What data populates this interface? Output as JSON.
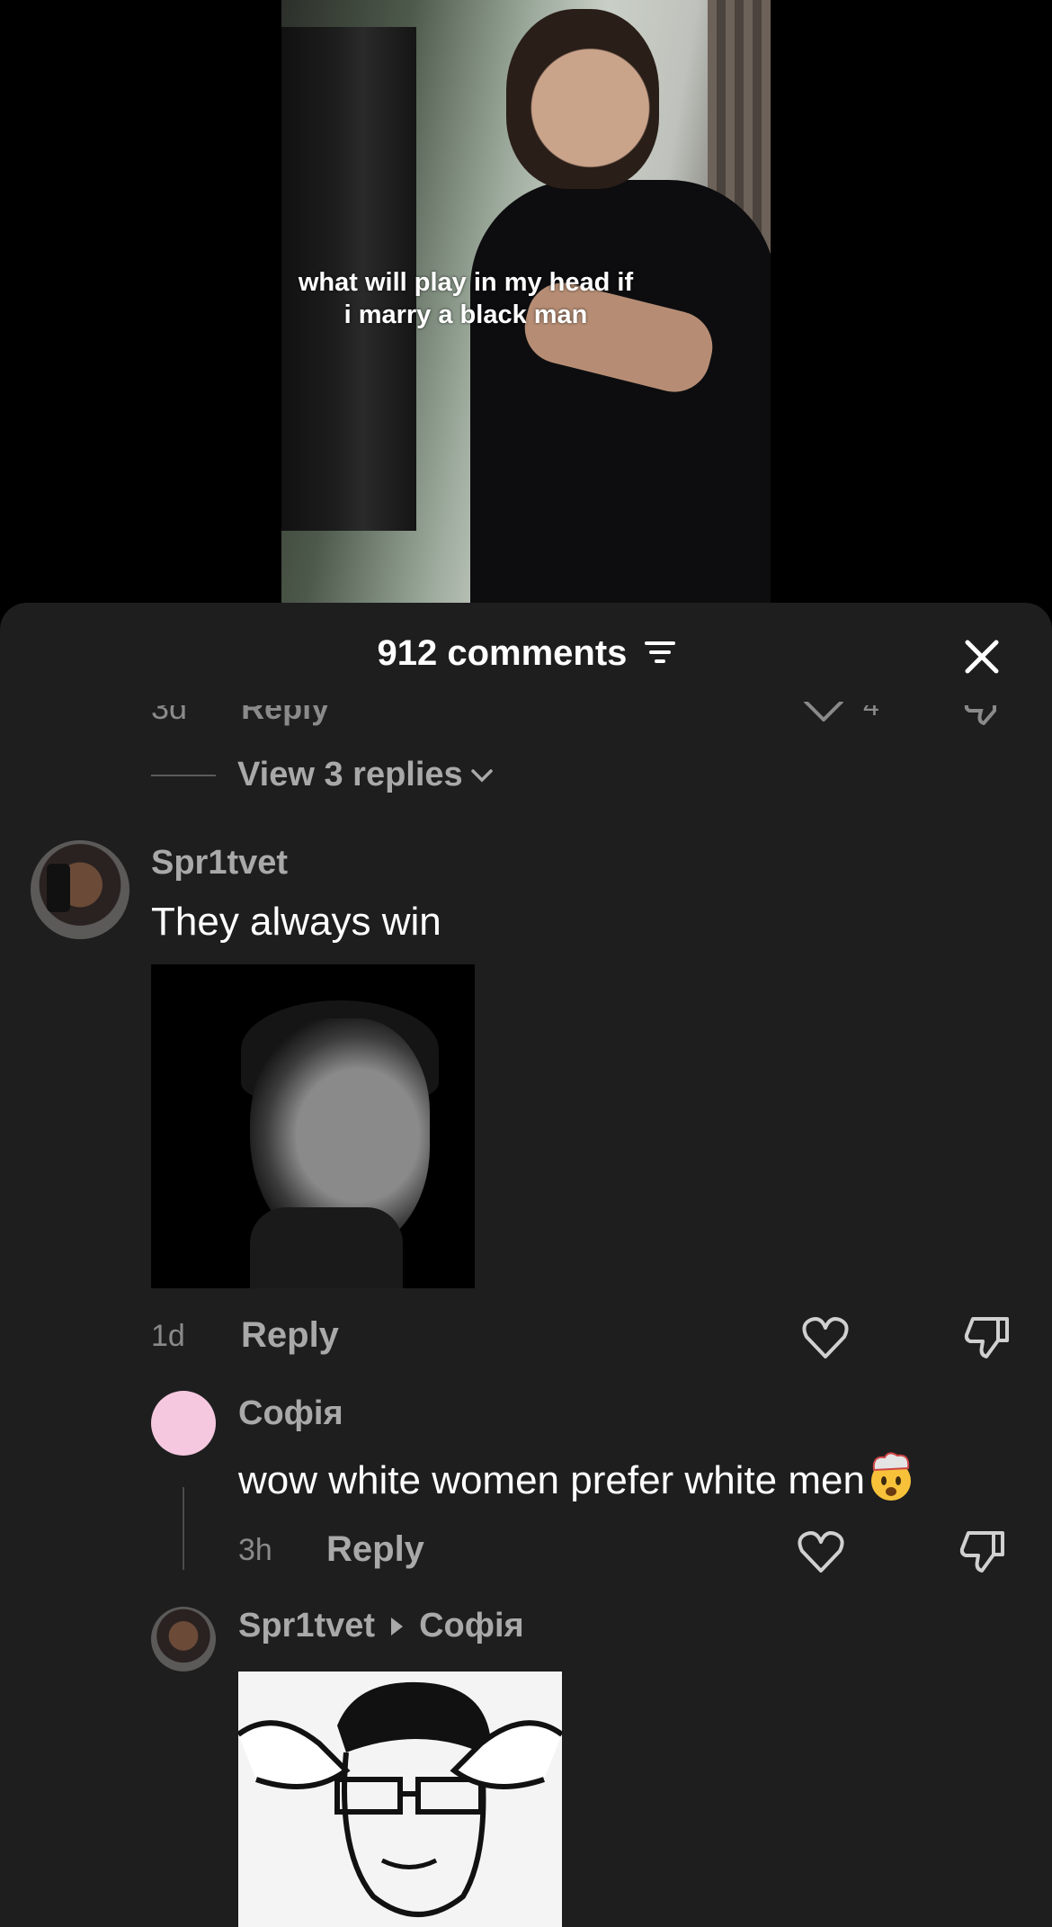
{
  "video": {
    "caption_line1": "what will play in my head if",
    "caption_line2": "i marry a black man"
  },
  "sheet": {
    "comment_count": "912 comments",
    "icons": {
      "filter": "filter-lines-icon",
      "close": "close-x-icon"
    }
  },
  "previous_comment": {
    "time_partial": "3d",
    "reply_label_partial": "Reply",
    "like_count_partial": "4",
    "view_replies": "View 3 replies"
  },
  "comment": {
    "username": "Spr1tvet",
    "text": "They always win",
    "time": "1d",
    "reply_label": "Reply"
  },
  "reply1": {
    "username": "Софія",
    "text": "wow white women prefer white men",
    "emoji": "exploding-head-emoji",
    "time": "3h",
    "reply_label": "Reply"
  },
  "reply2": {
    "username": "Spr1tvet",
    "reply_to": "Софія"
  },
  "colors": {
    "sheet_bg": "#1e1e1f",
    "muted_text": "#a9a9aa",
    "avatar_pink": "#f5c8df"
  }
}
